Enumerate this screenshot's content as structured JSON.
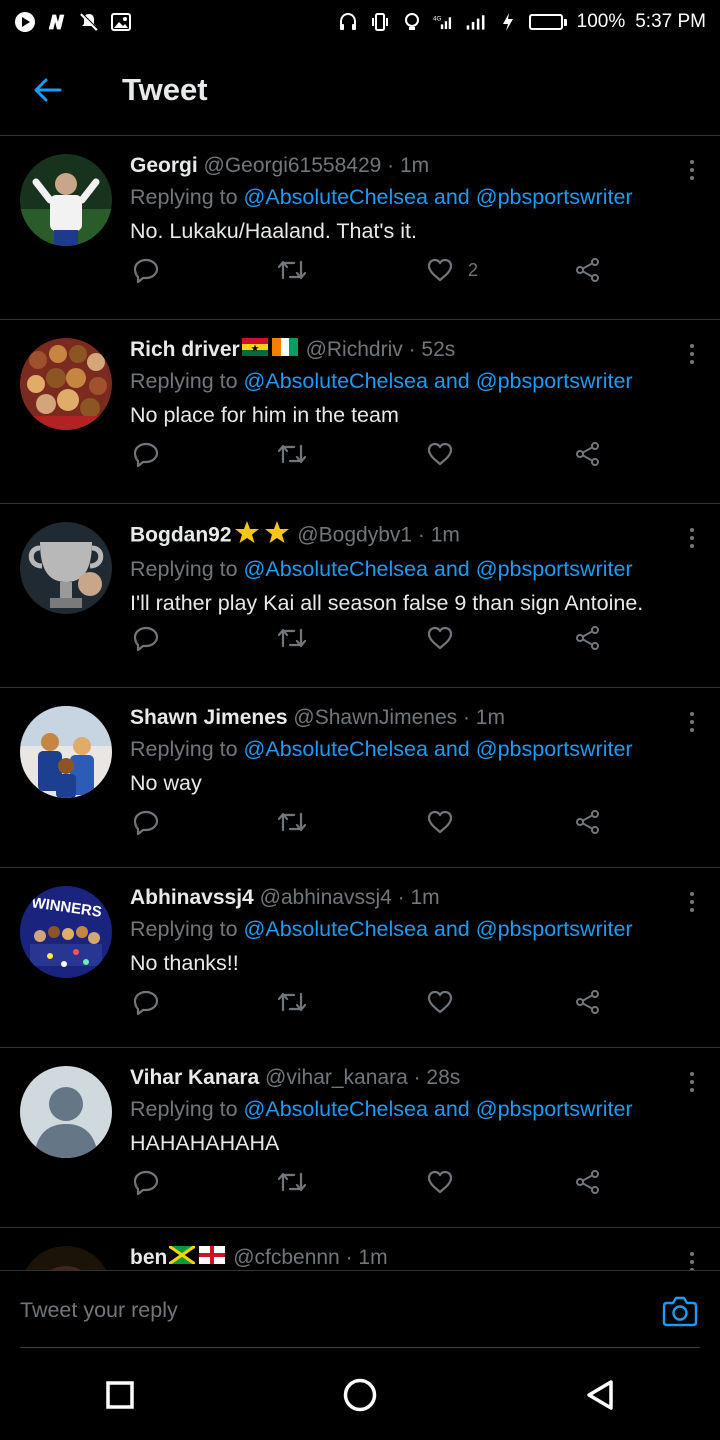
{
  "status_bar": {
    "battery": "100%",
    "time": "5:37 PM"
  },
  "header": {
    "title": "Tweet"
  },
  "colors": {
    "accent": "#1d9bf0",
    "muted": "#71767b",
    "divider": "#2f3336"
  },
  "tweets": [
    {
      "name": "Georgi",
      "handle": "@Georgi61558429 · 1m",
      "reply_prefix": "Replying to ",
      "reply_mentions": "@AbsoluteChelsea and @pbsportswriter",
      "text": "No. Lukaku/Haaland. That's it.",
      "likes": "2"
    },
    {
      "name": "Rich driver",
      "handle": "@Richdriv · 52s",
      "reply_prefix": "Replying to ",
      "reply_mentions": "@AbsoluteChelsea and @pbsportswriter",
      "text": "No place for him in the team",
      "likes": ""
    },
    {
      "name": "Bogdan92",
      "handle": "@Bogdybv1 · 1m",
      "reply_prefix": "Replying to ",
      "reply_mentions": "@AbsoluteChelsea and @pbsportswriter",
      "text": "I'll rather play  Kai all season false 9 than sign Antoine.",
      "likes": ""
    },
    {
      "name": "Shawn Jimenes",
      "handle": "@ShawnJimenes · 1m",
      "reply_prefix": "Replying to ",
      "reply_mentions": "@AbsoluteChelsea and @pbsportswriter",
      "text": "No way",
      "likes": ""
    },
    {
      "name": "Abhinavssj4",
      "handle": "@abhinavssj4 · 1m",
      "reply_prefix": "Replying to ",
      "reply_mentions": "@AbsoluteChelsea and @pbsportswriter",
      "text": "No thanks!!",
      "likes": ""
    },
    {
      "name": "Vihar Kanara",
      "handle": "@vihar_kanara · 28s",
      "reply_prefix": "Replying to ",
      "reply_mentions": "@AbsoluteChelsea and @pbsportswriter",
      "text": "HAHAHAHAHA",
      "likes": ""
    },
    {
      "name": "ben",
      "handle": "@cfcbennn · 1m",
      "reply_prefix": "",
      "reply_mentions": "",
      "text": "",
      "likes": ""
    }
  ],
  "reply_bar": {
    "placeholder": "Tweet your reply"
  }
}
